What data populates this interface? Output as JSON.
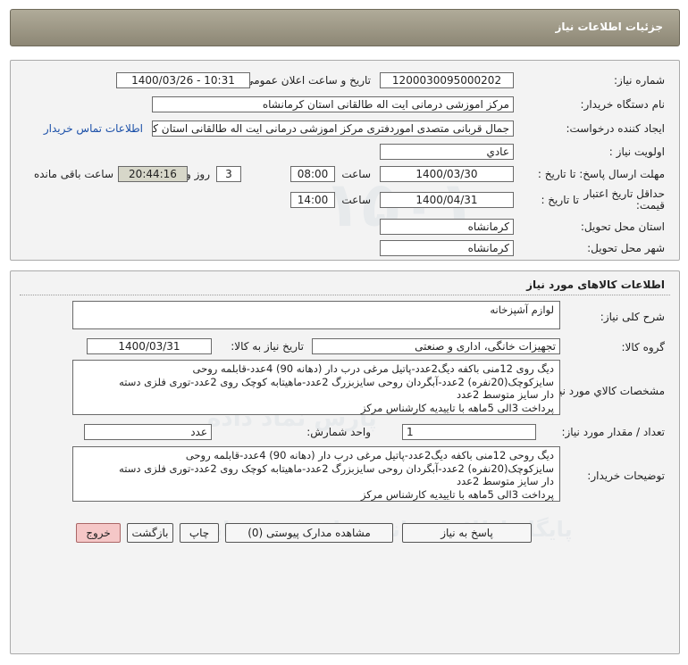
{
  "header": {
    "title": "جزئیات اطلاعات نیاز"
  },
  "info": {
    "need_number_label": "شماره نیاز:",
    "need_number": "1200030095000202",
    "announce_label": "تاریخ و ساعت اعلان عمومی:",
    "announce_value": "1400/03/26 - 10:31",
    "buyer_label": "نام دستگاه خریدار:",
    "buyer_value": "مرکز اموزشی درمانی ایت اله طالقانی استان کرمانشاه",
    "requester_label": "ایجاد کننده درخواست:",
    "requester_value": "جمال قربانی متصدی اموردفتری مرکز اموزشی درمانی ایت اله طالقانی استان کرمانشاه",
    "contact_link": "اطلاعات تماس خریدار",
    "priority_label": "اولویت نیاز :",
    "priority_value": "عادي",
    "deadline_label": "مهلت ارسال پاسخ: تا تاریخ :",
    "deadline_date": "1400/03/30",
    "time_label": "ساعت",
    "deadline_time": "08:00",
    "days_value": "3",
    "days_label": "روز و",
    "remaining_time": "20:44:16",
    "remaining_label": "ساعت باقی مانده",
    "validity_label_1": "حداقل تاریخ اعتبار",
    "validity_label_2": "قیمت:",
    "validity_to_label": "تا تاریخ :",
    "validity_date": "1400/04/31",
    "validity_time": "14:00",
    "province_label": "استان محل تحویل:",
    "province_value": "کرمانشاه",
    "city_label": "شهر محل تحویل:",
    "city_value": "کرمانشاه"
  },
  "goods": {
    "section_title": "اطلاعات کالاهای مورد نیاز",
    "desc_label": "شرح کلی نیاز:",
    "desc_value": "لوازم آشپزخانه",
    "group_label": "گروه کالا:",
    "group_value": "تجهیزات خانگی، اداری و صنعتی",
    "need_date_label": "تاریخ نیاز به کالا:",
    "need_date_value": "1400/03/31",
    "specs_label": "مشخصات کالاي مورد نياز:",
    "specs_value": "دیگ روی 12منی باکفه دیگ2عدد-پاتیل مرغی درب دار (دهانه 90) 4عدد-قابلمه روحی\nسایزکوچک(20نفره) 2عدد-آبگردان روحی سایزبزرگ 2عدد-ماهیتابه کوچک روی 2عدد-توری فلزی دسته\nدار سایز متوسط 2عدد\nپرداخت 3الی 5ماهه با تاییدیه کارشناس مرکز",
    "qty_label": "تعداد / مقدار مورد نیاز:",
    "qty_value": "1",
    "unit_label": "واحد شمارش:",
    "unit_value": "عدد",
    "buyer_notes_label": "توضیحات خریدار:",
    "buyer_notes_value": "دیگ روحی 12منی باکفه دیگ2عدد-پاتیل مرغی درب دار (دهانه 90) 4عدد-قابلمه روحی\nسایزکوچک(20نفره) 2عدد-آبگردان روحی سایزبزرگ 2عدد-ماهیتابه کوچک روی 2عدد-توری فلزی دسته\nدار سایز متوسط 2عدد\nپرداخت 3الی 5ماهه  با تاییدیه کارشناس مرکز"
  },
  "buttons": {
    "reply": "پاسخ به نیاز",
    "attachments": "مشاهده مدارک پیوستی (0)",
    "print": "چاپ",
    "back": "بازگشت",
    "exit": "خروج"
  }
}
